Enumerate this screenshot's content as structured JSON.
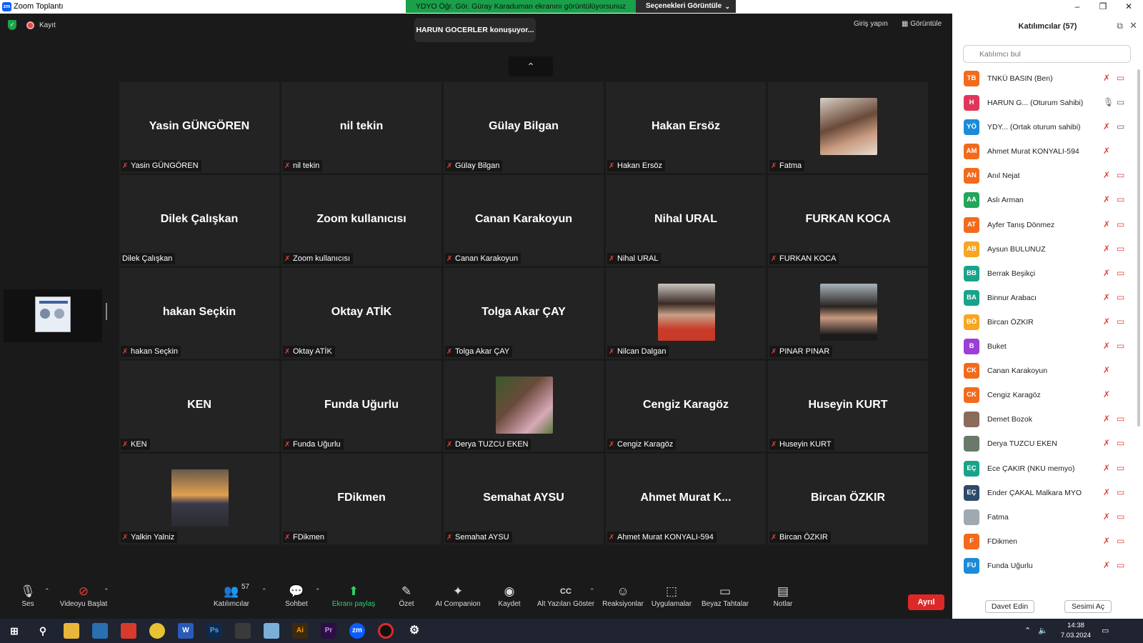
{
  "window": {
    "title": "Zoom Toplantı",
    "logo_text": "zm",
    "minimize": "–",
    "restore": "❐",
    "close": "✕"
  },
  "share_banner": {
    "text": "YDYO Öğr. Gör. Güray Karaduman ekranını görüntülüyorsunuz",
    "view_options": "Seçenekleri Görüntüle",
    "view_options_chevron": "⌄"
  },
  "meeting": {
    "recording_label": "Kayıt",
    "speaking_label": "HARUN GOCERLER konuşuyor...",
    "sign_in": "Giriş yapın",
    "view": "Görüntüle",
    "collapse_icon": "⌃"
  },
  "tiles": [
    {
      "display": "Yasin GÜNGÖREN",
      "label": "Yasin GÜNGÖREN",
      "muted": true,
      "photo": null
    },
    {
      "display": "nil tekin",
      "label": "nil tekin",
      "muted": true,
      "photo": null
    },
    {
      "display": "Gülay Bilgan",
      "label": "Gülay Bilgan",
      "muted": true,
      "photo": null
    },
    {
      "display": "Hakan Ersöz",
      "label": "Hakan Ersöz",
      "muted": true,
      "photo": null
    },
    {
      "display": "",
      "label": "Fatma",
      "muted": true,
      "photo": "woman-light"
    },
    {
      "display": "Dilek Çalışkan",
      "label": "Dilek Çalışkan",
      "muted": false,
      "photo": null
    },
    {
      "display": "Zoom kullanıcısı",
      "label": "Zoom kullanıcısı",
      "muted": true,
      "photo": null
    },
    {
      "display": "Canan Karakoyun",
      "label": "Canan Karakoyun",
      "muted": true,
      "photo": null
    },
    {
      "display": "Nihal URAL",
      "label": "Nihal URAL",
      "muted": true,
      "photo": null
    },
    {
      "display": "FURKAN KOCA",
      "label": "FURKAN KOCA",
      "muted": true,
      "photo": null
    },
    {
      "display": "hakan Seçkin",
      "label": "hakan Seçkin",
      "muted": true,
      "photo": null
    },
    {
      "display": "Oktay ATİK",
      "label": "Oktay ATİK",
      "muted": true,
      "photo": null
    },
    {
      "display": "Tolga Akar ÇAY",
      "label": "Tolga Akar ÇAY",
      "muted": true,
      "photo": null
    },
    {
      "display": "",
      "label": "Nilcan Dalgan",
      "muted": true,
      "photo": "woman-red"
    },
    {
      "display": "",
      "label": "PINAR PINAR",
      "muted": true,
      "photo": "woman-outdoor"
    },
    {
      "display": "KEN",
      "label": "KEN",
      "muted": true,
      "photo": null
    },
    {
      "display": "Funda Uğurlu",
      "label": "Funda Uğurlu",
      "muted": true,
      "photo": null
    },
    {
      "display": "",
      "label": "Derya TUZCU EKEN",
      "muted": true,
      "photo": "family"
    },
    {
      "display": "Cengiz Karagöz",
      "label": "Cengiz Karagöz",
      "muted": true,
      "photo": null
    },
    {
      "display": "Huseyin KURT",
      "label": "Huseyin KURT",
      "muted": true,
      "photo": null
    },
    {
      "display": "",
      "label": "Yalkin Yalniz",
      "muted": true,
      "photo": "sunset"
    },
    {
      "display": "FDikmen",
      "label": "FDikmen",
      "muted": true,
      "photo": null
    },
    {
      "display": "Semahat AYSU",
      "label": "Semahat AYSU",
      "muted": true,
      "photo": null
    },
    {
      "display": "Ahmet Murat K...",
      "label": "Ahmet Murat KONYALI-594",
      "muted": true,
      "photo": null
    },
    {
      "display": "Bircan ÖZKIR",
      "label": "Bircan ÖZKIR",
      "muted": true,
      "photo": null
    }
  ],
  "toolbar": {
    "audio": "Ses",
    "video": "Videoyu Başlat",
    "participants": "Katılımcılar",
    "participants_count": "57",
    "chat": "Sohbet",
    "share": "Ekranı paylaş",
    "summary": "Özet",
    "ai": "AI Companion",
    "record": "Kaydet",
    "captions": "Alt Yazıları Göster",
    "reactions": "Reaksiyonlar",
    "apps": "Uygulamalar",
    "whiteboards": "Beyaz Tahtalar",
    "notes": "Notlar",
    "leave": "Ayrıl",
    "captions_icon": "CC",
    "caret": "⌃"
  },
  "panel": {
    "title": "Katılımcılar (57)",
    "search_placeholder": "Katılımcı bul",
    "invite": "Davet Edin",
    "unmute": "Sesimi Aç",
    "participants": [
      {
        "initials": "TB",
        "color": "#f26b1d",
        "name": "TNKÜ BASIN (Ben)",
        "mic": "off",
        "cam": "off"
      },
      {
        "initials": "H",
        "color": "#e0365a",
        "name": "HARUN G...  (Oturum Sahibi)",
        "mic": "on",
        "cam": "on"
      },
      {
        "initials": "YÖ",
        "color": "#1b8bd8",
        "name": "YDY...  (Ortak oturum sahibi)",
        "mic": "off",
        "cam": "on"
      },
      {
        "initials": "AM",
        "color": "#f26b1d",
        "name": "Ahmet Murat KONYALI-594",
        "mic": "off",
        "cam": "none"
      },
      {
        "initials": "AN",
        "color": "#f26b1d",
        "name": "Anıl Nejat",
        "mic": "off",
        "cam": "off"
      },
      {
        "initials": "AA",
        "color": "#22a65a",
        "name": "Aslı Arman",
        "mic": "off",
        "cam": "off"
      },
      {
        "initials": "AT",
        "color": "#f26b1d",
        "name": "Ayfer Tanış Dönmez",
        "mic": "off",
        "cam": "off"
      },
      {
        "initials": "AB",
        "color": "#f6a623",
        "name": "Aysun BULUNUZ",
        "mic": "off",
        "cam": "off"
      },
      {
        "initials": "BB",
        "color": "#1aa38c",
        "name": "Berrak Beşikçi",
        "mic": "off",
        "cam": "off"
      },
      {
        "initials": "BA",
        "color": "#1aa38c",
        "name": "Binnur Arabacı",
        "mic": "off",
        "cam": "off"
      },
      {
        "initials": "BÖ",
        "color": "#f6a623",
        "name": "Bircan ÖZKIR",
        "mic": "off",
        "cam": "off"
      },
      {
        "initials": "B",
        "color": "#9b3fd6",
        "name": "Buket",
        "mic": "off",
        "cam": "off"
      },
      {
        "initials": "CK",
        "color": "#f26b1d",
        "name": "Canan Karakoyun",
        "mic": "off",
        "cam": "none"
      },
      {
        "initials": "CK",
        "color": "#f26b1d",
        "name": "Cengiz Karagöz",
        "mic": "off",
        "cam": "none"
      },
      {
        "initials": "",
        "color": "#8a6a5a",
        "name": "Demet Bozok",
        "mic": "off",
        "cam": "off"
      },
      {
        "initials": "",
        "color": "#6a7a6a",
        "name": "Derya TUZCU EKEN",
        "mic": "off",
        "cam": "off"
      },
      {
        "initials": "EÇ",
        "color": "#1aa38c",
        "name": "Ece ÇAKIR (NKU memyo)",
        "mic": "off",
        "cam": "off"
      },
      {
        "initials": "EÇ",
        "color": "#2d4a6a",
        "name": "Ender ÇAKAL Malkara MYO",
        "mic": "off",
        "cam": "off"
      },
      {
        "initials": "",
        "color": "#a0a8b0",
        "name": "Fatma",
        "mic": "off",
        "cam": "off"
      },
      {
        "initials": "F",
        "color": "#f26b1d",
        "name": "FDikmen",
        "mic": "off",
        "cam": "off"
      },
      {
        "initials": "FU",
        "color": "#1b8bd8",
        "name": "Funda Uğurlu",
        "mic": "off",
        "cam": "off"
      }
    ]
  },
  "taskbar": {
    "time": "14:38",
    "date": "7.03.2024"
  }
}
